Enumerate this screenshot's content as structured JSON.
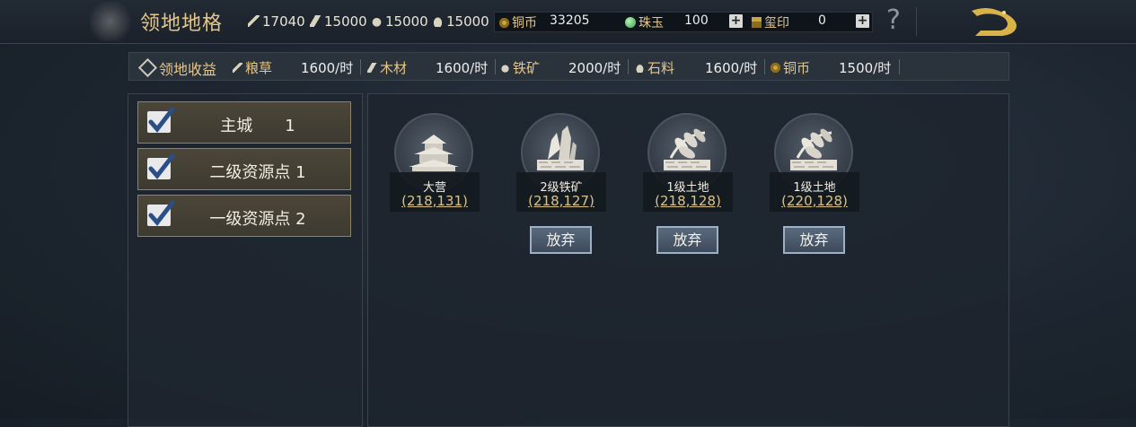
{
  "header": {
    "title": "领地地格",
    "resources": [
      {
        "icon": "grain-icon",
        "value": "17040"
      },
      {
        "icon": "wood-icon",
        "value": "15000"
      },
      {
        "icon": "iron-icon",
        "value": "15000"
      },
      {
        "icon": "stone-icon",
        "value": "15000"
      }
    ],
    "currencies": [
      {
        "icon": "coin-icon",
        "label": "铜币",
        "value": "33205"
      },
      {
        "icon": "jade-icon",
        "label": "珠玉",
        "value": "100"
      },
      {
        "icon": "seal-icon",
        "label": "玺印",
        "value": "0"
      }
    ],
    "plus": "+",
    "help": "?"
  },
  "income": {
    "title": "领地收益",
    "items": [
      {
        "icon": "grain-icon",
        "label": "粮草",
        "value": "1600/时"
      },
      {
        "icon": "wood-icon",
        "label": "木材",
        "value": "1600/时"
      },
      {
        "icon": "iron-icon",
        "label": "铁矿",
        "value": "2000/时"
      },
      {
        "icon": "stone-icon",
        "label": "石料",
        "value": "1600/时"
      },
      {
        "icon": "coin-icon",
        "label": "铜币",
        "value": "1500/时"
      }
    ]
  },
  "filters": [
    {
      "label": "主城　　1",
      "checked": true
    },
    {
      "label": "二级资源点 1",
      "checked": true
    },
    {
      "label": "一级资源点 2",
      "checked": true
    }
  ],
  "tiles": [
    {
      "icon": "camp-icon",
      "name": "大营",
      "coord": "(218,131)"
    },
    {
      "icon": "iron-mine-icon",
      "name": "2级铁矿",
      "coord": "(218,127)",
      "action": "放弃"
    },
    {
      "icon": "farmland-icon",
      "name": "1级土地",
      "coord": "(218,128)",
      "action": "放弃"
    },
    {
      "icon": "farmland-icon",
      "name": "1级土地",
      "coord": "(220,128)",
      "action": "放弃"
    }
  ]
}
